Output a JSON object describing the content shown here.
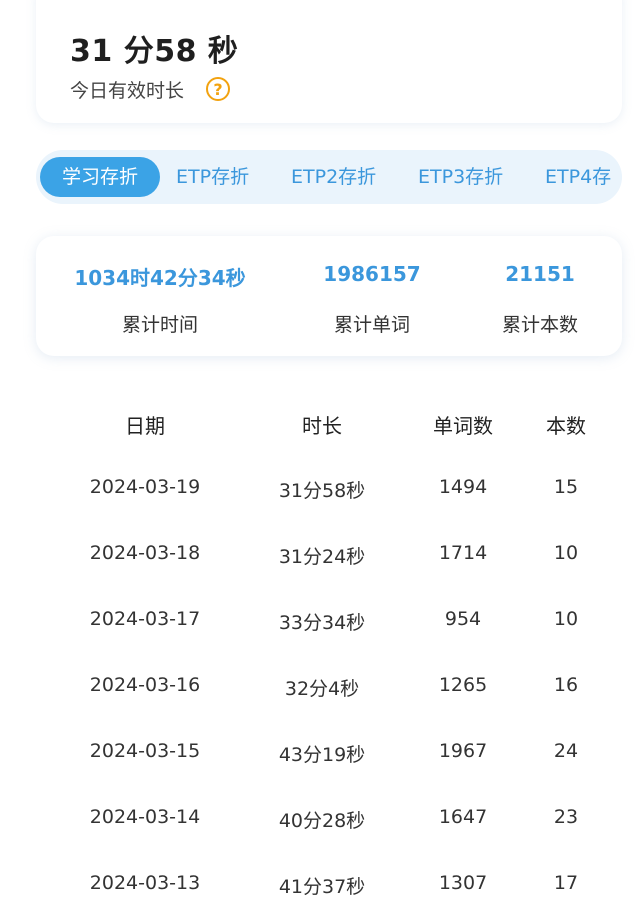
{
  "today": {
    "value": "31 分58 秒",
    "label": "今日有效时长",
    "help_icon": "question-circle-icon"
  },
  "tabs": [
    {
      "label": "学习存折",
      "active": true
    },
    {
      "label": "ETP存折",
      "active": false
    },
    {
      "label": "ETP2存折",
      "active": false
    },
    {
      "label": "ETP3存折",
      "active": false
    },
    {
      "label": "ETP4存",
      "active": false
    }
  ],
  "summary": [
    {
      "value": "1034时42分34秒",
      "label": "累计时间"
    },
    {
      "value": "1986157",
      "label": "累计单词"
    },
    {
      "value": "21151",
      "label": "累计本数"
    }
  ],
  "table": {
    "headers": [
      "日期",
      "时长",
      "单词数",
      "本数"
    ],
    "rows": [
      [
        "2024-03-19",
        "31分58秒",
        "1494",
        "15"
      ],
      [
        "2024-03-18",
        "31分24秒",
        "1714",
        "10"
      ],
      [
        "2024-03-17",
        "33分34秒",
        "954",
        "10"
      ],
      [
        "2024-03-16",
        "32分4秒",
        "1265",
        "16"
      ],
      [
        "2024-03-15",
        "43分19秒",
        "1967",
        "24"
      ],
      [
        "2024-03-14",
        "40分28秒",
        "1647",
        "23"
      ],
      [
        "2024-03-13",
        "41分37秒",
        "1307",
        "17"
      ]
    ]
  },
  "colors": {
    "accent": "#3b97dc",
    "active_tab": "#3ba3e6",
    "help": "#f2a20f"
  }
}
